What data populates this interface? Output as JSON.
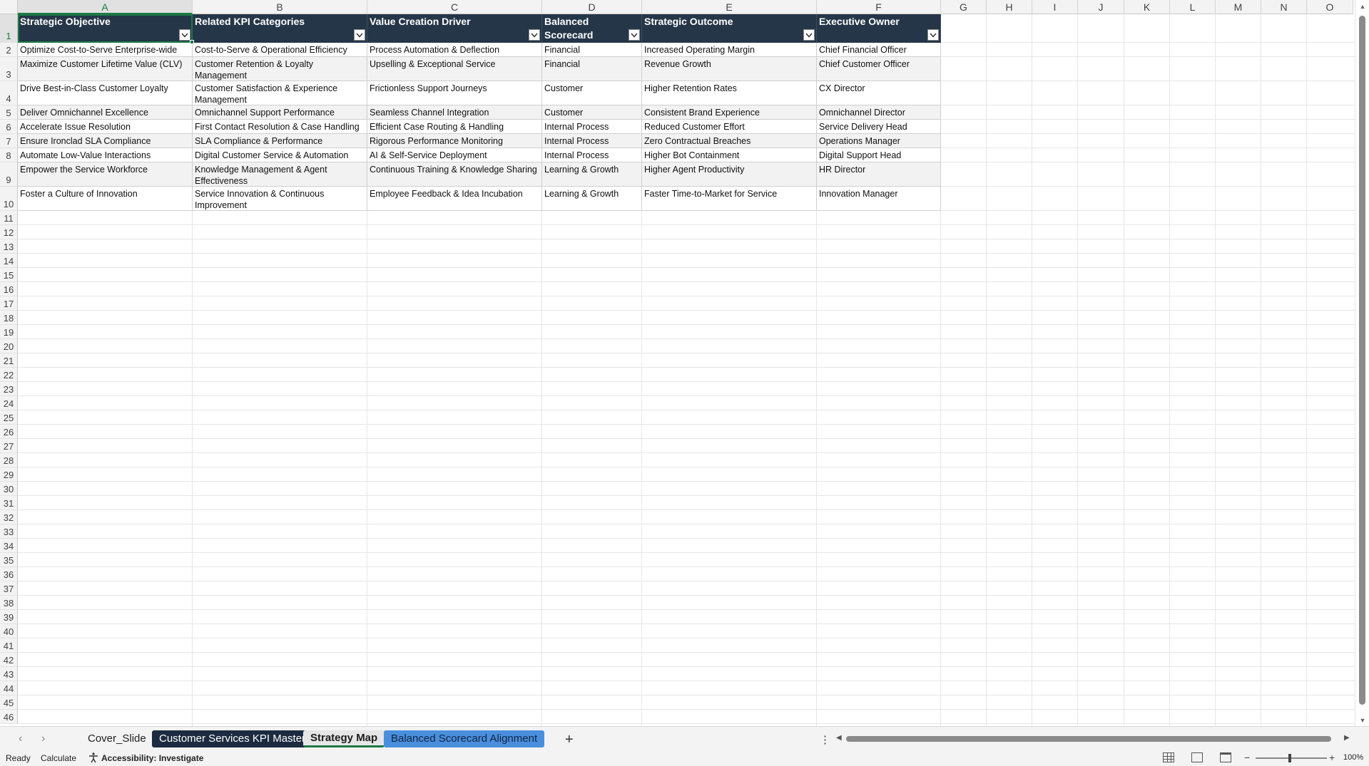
{
  "columns": [
    "A",
    "B",
    "C",
    "D",
    "E",
    "F",
    "G",
    "H",
    "I",
    "J",
    "K",
    "L",
    "M",
    "N",
    "O"
  ],
  "selected_column": "A",
  "selected_row": "1",
  "row_numbers": [
    "1",
    "2",
    "3",
    "4",
    "5",
    "6",
    "7",
    "8",
    "9",
    "10",
    "11",
    "12",
    "13",
    "14",
    "15",
    "16",
    "17",
    "18",
    "19",
    "20",
    "21",
    "22",
    "23",
    "24",
    "25",
    "26",
    "27",
    "28",
    "29",
    "30",
    "31",
    "32",
    "33",
    "34",
    "35",
    "36",
    "37",
    "38",
    "39",
    "40",
    "41",
    "42",
    "43",
    "44",
    "45",
    "46"
  ],
  "table": {
    "headers": [
      "Strategic Objective",
      "Related KPI Categories",
      "Value Creation Driver",
      "Balanced Scorecard Perspective",
      "Strategic Outcome",
      "Executive Owner"
    ],
    "rows": [
      [
        "Optimize Cost-to-Serve Enterprise-wide",
        "Cost-to-Serve & Operational Efficiency",
        "Process Automation & Deflection",
        "Financial",
        "Increased Operating Margin",
        "Chief Financial Officer"
      ],
      [
        "Maximize Customer Lifetime Value (CLV)",
        "Customer Retention & Loyalty Management",
        "Upselling & Exceptional Service",
        "Financial",
        "Revenue Growth",
        "Chief Customer Officer"
      ],
      [
        "Drive Best-in-Class Customer Loyalty",
        "Customer Satisfaction & Experience Management",
        "Frictionless Support Journeys",
        "Customer",
        "Higher Retention Rates",
        "CX Director"
      ],
      [
        "Deliver Omnichannel Excellence",
        "Omnichannel Support Performance",
        "Seamless Channel Integration",
        "Customer",
        "Consistent Brand Experience",
        "Omnichannel Director"
      ],
      [
        "Accelerate Issue Resolution",
        "First Contact Resolution & Case Handling",
        "Efficient Case Routing & Handling",
        "Internal Process",
        "Reduced Customer Effort",
        "Service Delivery Head"
      ],
      [
        "Ensure Ironclad SLA Compliance",
        "SLA Compliance & Performance",
        "Rigorous Performance Monitoring",
        "Internal Process",
        "Zero Contractual Breaches",
        "Operations Manager"
      ],
      [
        "Automate Low-Value Interactions",
        "Digital Customer Service & Automation",
        "AI & Self-Service Deployment",
        "Internal Process",
        "Higher Bot Containment",
        "Digital Support Head"
      ],
      [
        "Empower the Service Workforce",
        "Knowledge Management & Agent Effectiveness",
        "Continuous Training & Knowledge Sharing",
        "Learning & Growth",
        "Higher Agent Productivity",
        "HR Director"
      ],
      [
        "Foster a Culture of Innovation",
        "Service Innovation & Continuous Improvement",
        "Employee Feedback & Idea Incubation",
        "Learning & Growth",
        "Faster Time-to-Market for Service",
        "Innovation Manager"
      ]
    ]
  },
  "sheet_tabs": [
    {
      "label": "Cover_Slide",
      "style": "plain"
    },
    {
      "label": "Customer Services KPI Master",
      "style": "dark"
    },
    {
      "label": "Strategy Map",
      "style": "active"
    },
    {
      "label": "Balanced Scorecard Alignment",
      "style": "blue"
    }
  ],
  "add_sheet_label": "+",
  "tab_menu_label": "⋮",
  "status": {
    "ready": "Ready",
    "calculate": "Calculate",
    "accessibility": "Accessibility: Investigate",
    "zoom": "100%"
  },
  "icons": {
    "filter": "filter-dropdown-icon",
    "accessibility": "accessibility-icon",
    "normal_view": "normal-view-icon",
    "page_layout": "page-layout-icon",
    "page_break": "page-break-preview-icon"
  },
  "colors": {
    "header_fill": "#253648",
    "band_fill": "#f2f2f2",
    "selection": "#1b7a45",
    "tab_dark": "#1c2b40",
    "tab_blue": "#4a8fde"
  }
}
